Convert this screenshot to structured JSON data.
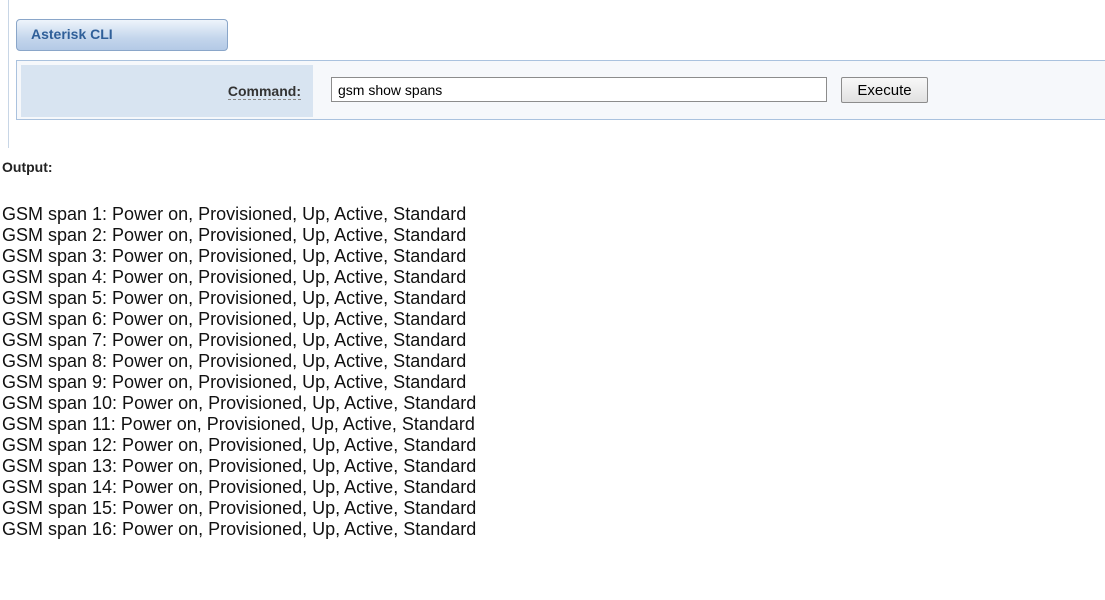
{
  "tab": {
    "label": "Asterisk CLI"
  },
  "command": {
    "label": "Command:",
    "value": "gsm show spans",
    "execute_label": "Execute"
  },
  "output": {
    "label": "Output:",
    "lines": [
      "GSM span 1: Power on, Provisioned, Up, Active, Standard",
      "GSM span 2: Power on, Provisioned, Up, Active, Standard",
      "GSM span 3: Power on, Provisioned, Up, Active, Standard",
      "GSM span 4: Power on, Provisioned, Up, Active, Standard",
      "GSM span 5: Power on, Provisioned, Up, Active, Standard",
      "GSM span 6: Power on, Provisioned, Up, Active, Standard",
      "GSM span 7: Power on, Provisioned, Up, Active, Standard",
      "GSM span 8: Power on, Provisioned, Up, Active, Standard",
      "GSM span 9: Power on, Provisioned, Up, Active, Standard",
      "GSM span 10: Power on, Provisioned, Up, Active, Standard",
      "GSM span 11: Power on, Provisioned, Up, Active, Standard",
      "GSM span 12: Power on, Provisioned, Up, Active, Standard",
      "GSM span 13: Power on, Provisioned, Up, Active, Standard",
      "GSM span 14: Power on, Provisioned, Up, Active, Standard",
      "GSM span 15: Power on, Provisioned, Up, Active, Standard",
      "GSM span 16: Power on, Provisioned, Up, Active, Standard"
    ]
  },
  "colors": {
    "tab_text": "#2f5f99",
    "label_cell_bg": "#d8e4f1",
    "panel_border": "#aac2de"
  }
}
